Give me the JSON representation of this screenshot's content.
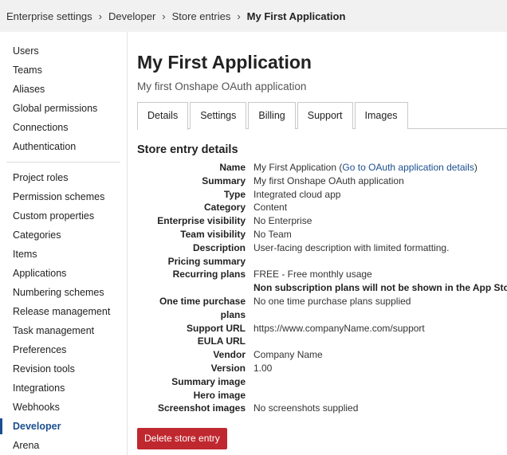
{
  "breadcrumb": {
    "items": [
      "Enterprise settings",
      "Developer",
      "Store entries"
    ],
    "current": "My First Application"
  },
  "sidebar": {
    "group1": [
      "Users",
      "Teams",
      "Aliases",
      "Global permissions",
      "Connections",
      "Authentication"
    ],
    "group2": [
      "Project roles",
      "Permission schemes",
      "Custom properties",
      "Categories",
      "Items",
      "Applications",
      "Numbering schemes",
      "Release management",
      "Task management",
      "Preferences",
      "Revision tools",
      "Integrations",
      "Webhooks",
      "Developer",
      "Arena"
    ],
    "active": "Developer"
  },
  "main": {
    "title": "My First Application",
    "subtitle": "My first Onshape OAuth application",
    "tabs": [
      "Details",
      "Settings",
      "Billing",
      "Support",
      "Images"
    ],
    "active_tab": "Details",
    "section_title": "Store entry details",
    "fields": {
      "name_label": "Name",
      "name_value": "My First Application",
      "name_link": "Go to OAuth application details",
      "summary_label": "Summary",
      "summary_value": "My first Onshape OAuth application",
      "type_label": "Type",
      "type_value": "Integrated cloud app",
      "category_label": "Category",
      "category_value": "Content",
      "enterprise_visibility_label": "Enterprise visibility",
      "enterprise_visibility_value": "No Enterprise",
      "team_visibility_label": "Team visibility",
      "team_visibility_value": "No Team",
      "description_label": "Description",
      "description_value": "User-facing description with limited formatting.",
      "pricing_summary_label": "Pricing summary",
      "pricing_summary_value": "",
      "recurring_plans_label": "Recurring plans",
      "recurring_plans_value": "FREE - Free monthly usage",
      "recurring_plans_note": "Non subscription plans will not be shown in the App Store",
      "one_time_label": "One time purchase plans",
      "one_time_value": "No one time purchase plans supplied",
      "support_url_label": "Support URL",
      "support_url_value": "https://www.companyName.com/support",
      "eula_url_label": "EULA URL",
      "eula_url_value": "",
      "vendor_label": "Vendor",
      "vendor_value": "Company Name",
      "version_label": "Version",
      "version_value": "1.00",
      "summary_image_label": "Summary image",
      "summary_image_value": "",
      "hero_image_label": "Hero image",
      "hero_image_value": "",
      "screenshot_images_label": "Screenshot images",
      "screenshot_images_value": "No screenshots supplied"
    },
    "delete_button": "Delete store entry"
  },
  "colors": {
    "accent": "#1b4f8f",
    "danger": "#c0282f",
    "breadcrumb_bg": "#f1f1f2"
  }
}
